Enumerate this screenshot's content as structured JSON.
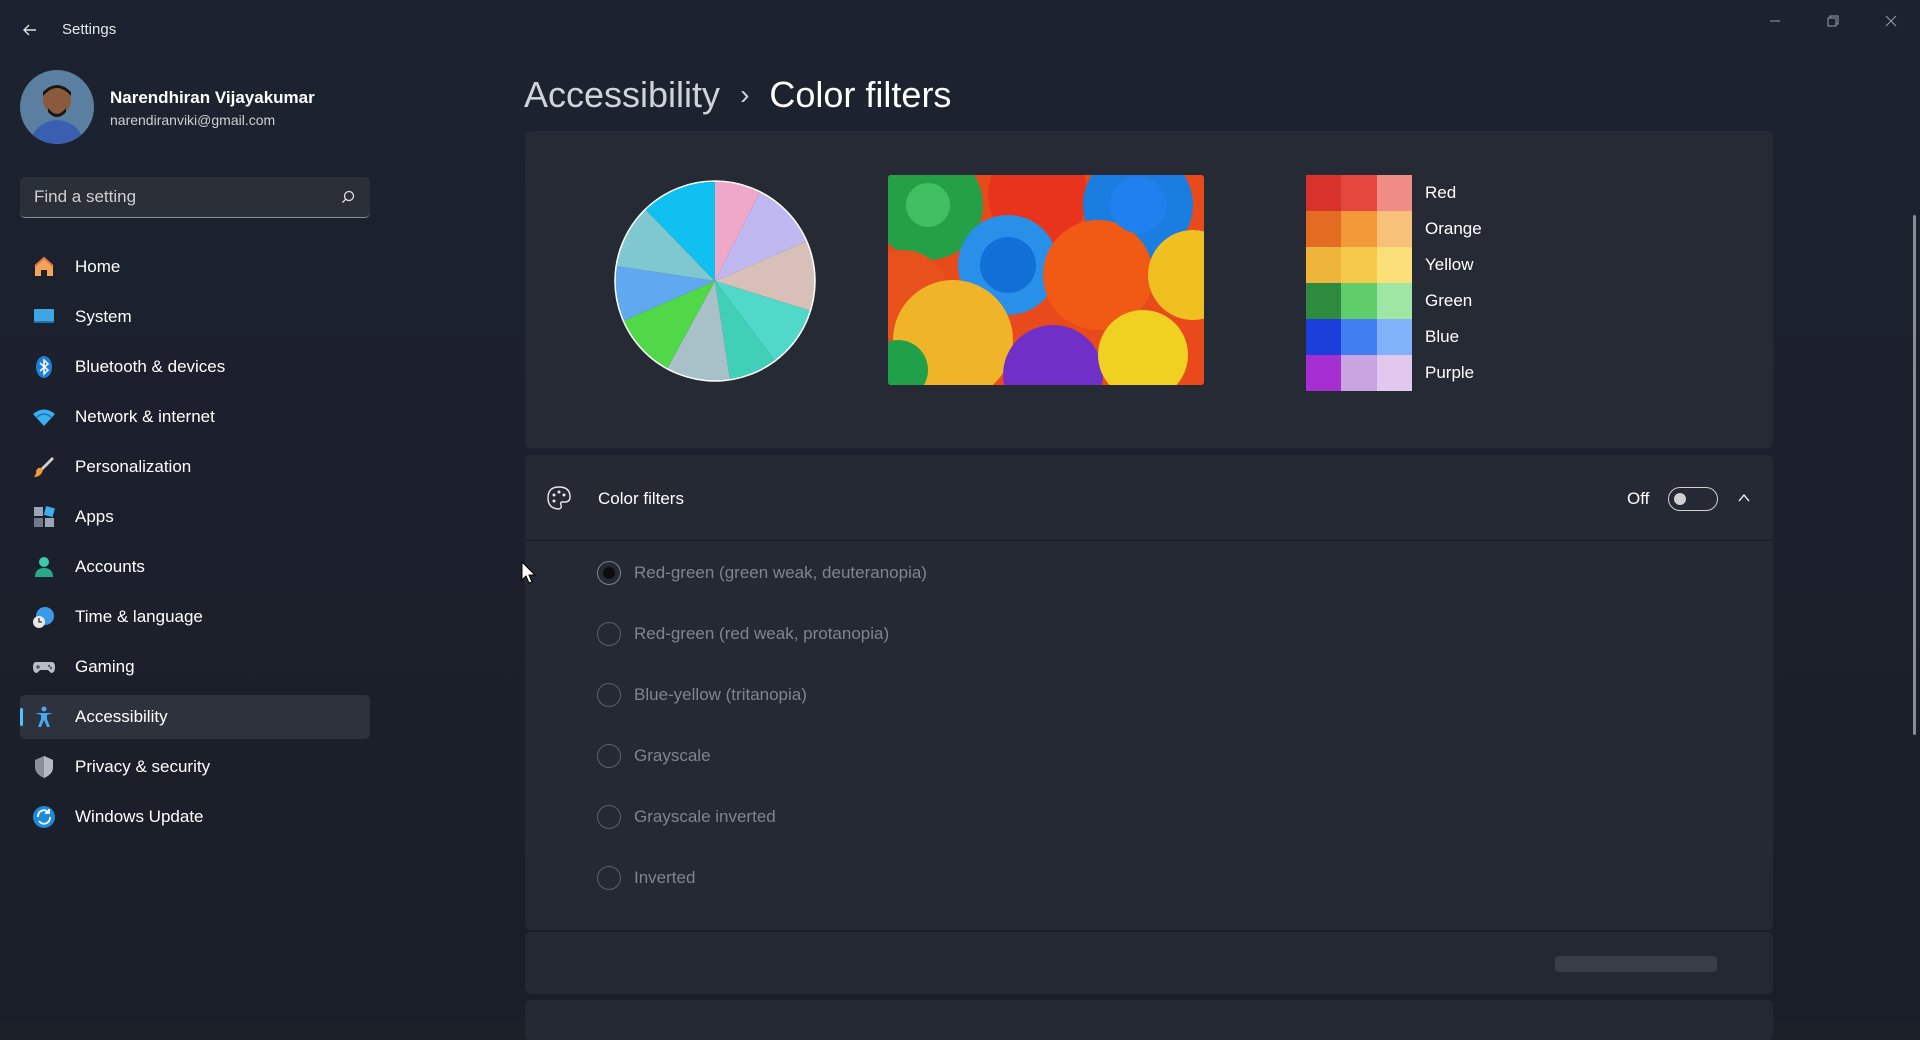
{
  "app": {
    "title": "Settings"
  },
  "user": {
    "name": "Narendhiran Vijayakumar",
    "email": "narendiranviki@gmail.com"
  },
  "search": {
    "placeholder": "Find a setting"
  },
  "sidebar": {
    "items": [
      {
        "label": "Home",
        "icon": "home-icon"
      },
      {
        "label": "System",
        "icon": "system-icon"
      },
      {
        "label": "Bluetooth & devices",
        "icon": "bluetooth-icon"
      },
      {
        "label": "Network & internet",
        "icon": "wifi-icon"
      },
      {
        "label": "Personalization",
        "icon": "brush-icon"
      },
      {
        "label": "Apps",
        "icon": "apps-icon"
      },
      {
        "label": "Accounts",
        "icon": "accounts-icon"
      },
      {
        "label": "Time & language",
        "icon": "clock-icon"
      },
      {
        "label": "Gaming",
        "icon": "gamepad-icon"
      },
      {
        "label": "Accessibility",
        "icon": "accessibility-icon",
        "active": true
      },
      {
        "label": "Privacy & security",
        "icon": "shield-icon"
      },
      {
        "label": "Windows Update",
        "icon": "update-icon"
      }
    ]
  },
  "breadcrumb": {
    "parent": "Accessibility",
    "separator": "›",
    "current": "Color filters"
  },
  "preview": {
    "colors": [
      {
        "name": "Red",
        "swatches": [
          "#d9322a",
          "#e5473f",
          "#ef8c86"
        ]
      },
      {
        "name": "Orange",
        "swatches": [
          "#e36b22",
          "#f29a3a",
          "#f8c17a"
        ]
      },
      {
        "name": "Yellow",
        "swatches": [
          "#efb53a",
          "#f6c94a",
          "#fbe07a"
        ]
      },
      {
        "name": "Green",
        "swatches": [
          "#2e8a3c",
          "#5fcd6a",
          "#9fe6a4"
        ]
      },
      {
        "name": "Blue",
        "swatches": [
          "#1c3fdc",
          "#3f7ff2",
          "#7fb2f8"
        ]
      },
      {
        "name": "Purple",
        "swatches": [
          "#a52fd0",
          "#c8a4e0",
          "#e2c8ef"
        ]
      }
    ]
  },
  "color_filters": {
    "title": "Color filters",
    "toggle_state": "Off",
    "options": [
      {
        "label": "Red-green (green weak, deuteranopia)",
        "checked": true
      },
      {
        "label": "Red-green (red weak, protanopia)",
        "checked": false
      },
      {
        "label": "Blue-yellow (tritanopia)",
        "checked": false
      },
      {
        "label": "Grayscale",
        "checked": false
      },
      {
        "label": "Grayscale inverted",
        "checked": false
      },
      {
        "label": "Inverted",
        "checked": false
      }
    ]
  },
  "colors": {
    "accent": "#4cc2ff",
    "card": "#252934",
    "background": "#1c2029"
  }
}
